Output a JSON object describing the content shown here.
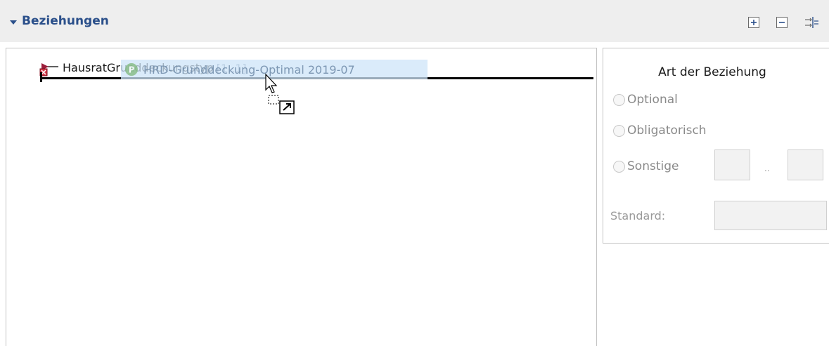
{
  "section": {
    "title": "Beziehungen",
    "toggle_icon": "triangle-down-icon",
    "toolbar": [
      {
        "icon": "expand-all-icon"
      },
      {
        "icon": "collapse-all-icon"
      },
      {
        "icon": "layout-toggle-icon"
      }
    ]
  },
  "tree": {
    "node": {
      "label": "HausratGrunddeckungstyp",
      "cardinality": "[1..1]",
      "icon": "association-icon"
    },
    "drag_ghost": {
      "label": "HRD-Grunddeckung-Optimal 2019-07",
      "icon": "product-cmpt-icon"
    }
  },
  "relation": {
    "title": "Art der Beziehung",
    "options": [
      {
        "label": "Optional",
        "selected": false
      },
      {
        "label": "Obligatorisch",
        "selected": false
      },
      {
        "label": "Sonstige",
        "selected": false
      }
    ],
    "range_separator": "..",
    "min_value": "",
    "max_value": "",
    "standard_label": "Standard:",
    "standard_value": ""
  },
  "colors": {
    "accent": "#2a4f8a",
    "header_bg": "#eeeeee",
    "drop_indicator": "#000000",
    "ghost_bg": "#cde4f8"
  }
}
